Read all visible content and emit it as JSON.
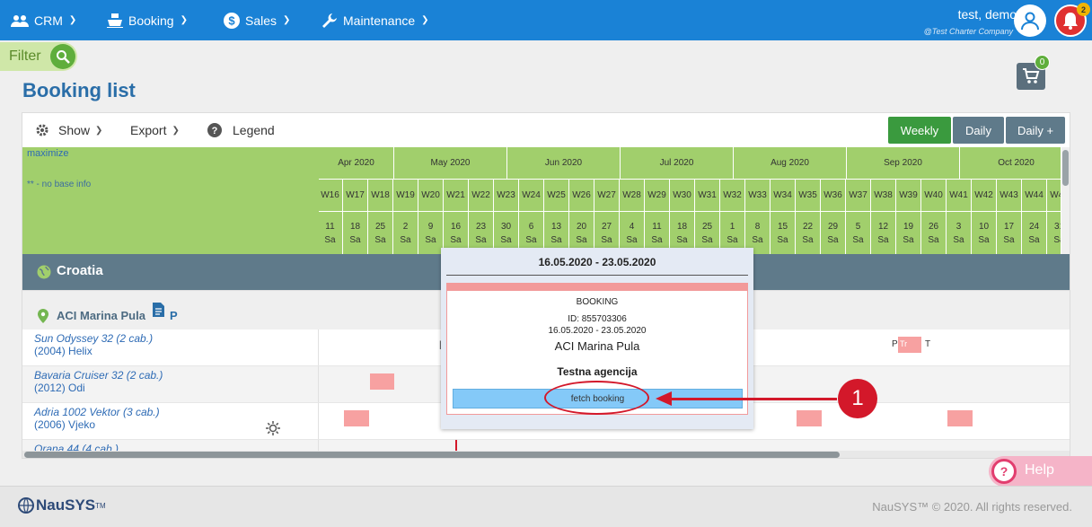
{
  "nav": {
    "items": [
      {
        "label": "CRM",
        "icon": "users-icon"
      },
      {
        "label": "Booking",
        "icon": "ship-icon"
      },
      {
        "label": "Sales",
        "icon": "dollar-icon"
      },
      {
        "label": "Maintenance",
        "icon": "wrench-icon"
      }
    ],
    "user_name": "test, demo",
    "user_company": "@Test Charter Company",
    "notifications_count": "2"
  },
  "filter": {
    "label": "Filter"
  },
  "cart": {
    "count": "0"
  },
  "page": {
    "title": "Booking list"
  },
  "toolbar": {
    "show_label": "Show",
    "export_label": "Export",
    "legend_label": "Legend",
    "views": [
      "Weekly",
      "Daily",
      "Daily +"
    ],
    "active_view": "Weekly"
  },
  "grid": {
    "maximize_label": "maximize",
    "no_base_info": "** - no base info",
    "months": [
      "Apr 2020",
      "May 2020",
      "Jun 2020",
      "Jul 2020",
      "Aug 2020",
      "Sep 2020",
      "Oct 2020"
    ],
    "weeks": [
      "W16",
      "W17",
      "W18",
      "W19",
      "W20",
      "W21",
      "W22",
      "W23",
      "W24",
      "W25",
      "W26",
      "W27",
      "W28",
      "W29",
      "W30",
      "W31",
      "W32",
      "W33",
      "W34",
      "W35",
      "W36",
      "W37",
      "W38",
      "W39",
      "W40",
      "W41",
      "W42",
      "W43",
      "W44",
      "W45"
    ],
    "days": [
      "11",
      "18",
      "25",
      "2",
      "9",
      "16",
      "23",
      "30",
      "6",
      "13",
      "20",
      "27",
      "4",
      "11",
      "18",
      "25",
      "1",
      "8",
      "15",
      "22",
      "29",
      "5",
      "12",
      "19",
      "26",
      "3",
      "10",
      "17",
      "24",
      "31"
    ],
    "day_label": "Sa",
    "region": "Croatia",
    "marina": "ACI Marina Pula",
    "marina_suffix": "P",
    "yachts": [
      {
        "name": "Sun Odyssey 32 (2 cab.)",
        "year": "(2004) Helix"
      },
      {
        "name": "Bavaria Cruiser 32 (2 cab.)",
        "year": "(2012) Odi"
      },
      {
        "name": "Adria 1002 Vektor (3 cab.)",
        "year": "(2006) Vjeko"
      },
      {
        "name": "Orana 44 (4 cab.)",
        "year": ""
      }
    ],
    "row1_marks": {
      "p": "P",
      "tr": "Tr",
      "t": "T"
    }
  },
  "popup": {
    "dates": "16.05.2020 - 23.05.2020",
    "type": "BOOKING",
    "id": "ID: 855703306",
    "period": "16.05.2020 - 23.05.2020",
    "marina": "ACI Marina Pula",
    "agency": "Testna agencija",
    "fetch_label": "fetch booking"
  },
  "annotation": {
    "number": "1"
  },
  "help": {
    "label": "Help"
  },
  "footer": {
    "logo": "NauSYS",
    "copyright": "NauSYS™ © 2020. All rights reserved."
  },
  "colors": {
    "nav": "#1a82d6",
    "calendar_green": "#a1cf6c",
    "weekly_active": "#3a9a3e",
    "view_inactive": "#5f7a8a",
    "booking_block": "#f7a1a1",
    "annotation_red": "#d3182a"
  }
}
